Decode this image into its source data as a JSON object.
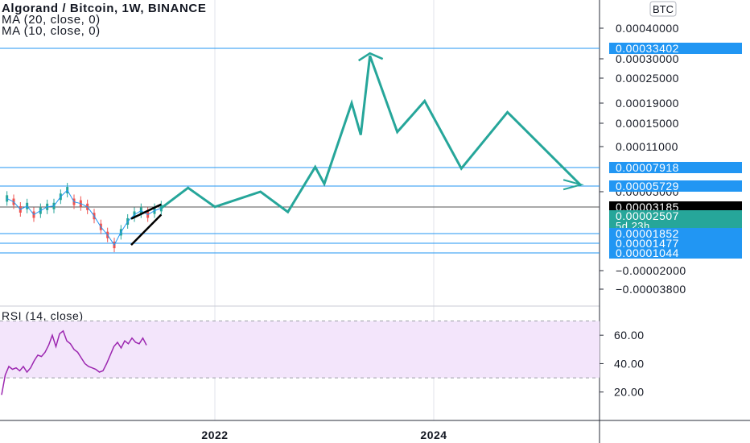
{
  "header": {
    "title": "Algorand / Bitcoin, 1W, BINANCE",
    "indicator_1": "MA (20, close, 0)",
    "indicator_2": "MA (10, close, 0)",
    "currency_badge": "BTC"
  },
  "rsi_panel": {
    "title": "RSI (14, close)",
    "upper_band": 70,
    "lower_band": 30,
    "band_fill": "#f3e5fb",
    "line_color": "#9c27b0"
  },
  "colors": {
    "projection": "#26a69a",
    "hline": "#2196f3",
    "price_tag_dark": "#000000",
    "price_tag_current": "#26a69a",
    "grid": "#e0e3eb"
  },
  "chart_data": [
    {
      "type": "line",
      "panel": "price",
      "title": "Algorand / Bitcoin, 1W, BINANCE",
      "x_ticks": [
        "2022",
        "2024"
      ],
      "y_ticks": [
        "0.00040000",
        "0.00030000",
        "0.00025000",
        "0.00019000",
        "0.00015000",
        "0.00011000",
        "0.00005000",
        "−0.00002000",
        "−0.00003800"
      ],
      "price_tags": [
        {
          "label": "0.00033402",
          "value": 0.00033402,
          "style": "blue"
        },
        {
          "label": "0.00007918",
          "value": 7.918e-05,
          "style": "blue"
        },
        {
          "label": "0.00005729",
          "value": 5.729e-05,
          "style": "blue"
        },
        {
          "label": "0.00003185",
          "value": 3.185e-05,
          "style": "dark"
        },
        {
          "label": "0.00002507",
          "value": 2.507e-05,
          "style": "current",
          "countdown": "5d 23h"
        },
        {
          "label": "0.00001852",
          "value": 1.852e-05,
          "style": "blue"
        },
        {
          "label": "0.00001477",
          "value": 1.477e-05,
          "style": "blue"
        },
        {
          "label": "0.00001044",
          "value": 1.044e-05,
          "style": "blue"
        }
      ],
      "horizontal_levels": [
        0.00033402,
        7.918e-05,
        5.729e-05,
        3.185e-05,
        1.852e-05,
        1.477e-05,
        1.044e-05
      ],
      "price_series": {
        "x": [
          "2019-06",
          "2019-07",
          "2019-08",
          "2019-09",
          "2019-10",
          "2019-11",
          "2019-12",
          "2020-01",
          "2020-02",
          "2020-03",
          "2020-04",
          "2020-05",
          "2020-06",
          "2020-07",
          "2020-08",
          "2020-09",
          "2020-10",
          "2020-11",
          "2020-12",
          "2021-01",
          "2021-02",
          "2021-03",
          "2021-04",
          "2021-05"
        ],
        "y": [
          4.2e-05,
          3.8e-05,
          3e-05,
          3.3e-05,
          2.6e-05,
          2.9e-05,
          3.2e-05,
          3.3e-05,
          4.4e-05,
          5.2e-05,
          3.8e-05,
          3.6e-05,
          3.2e-05,
          2.5e-05,
          2.1e-05,
          1.8e-05,
          1.4e-05,
          1.9e-05,
          2.3e-05,
          2.6e-05,
          2.9e-05,
          2.6e-05,
          2.9e-05,
          3.1e-05
        ]
      },
      "projection": {
        "name": "",
        "x": [
          "2021-05",
          "2021-09",
          "2022-01",
          "2022-06",
          "2022-09",
          "2022-12",
          "2023-01",
          "2023-04",
          "2023-05",
          "2023-06",
          "2023-09",
          "2023-12",
          "2024-04",
          "2024-09",
          "2025-05"
        ],
        "y": [
          3.1e-05,
          5.5e-05,
          3.2e-05,
          5e-05,
          2.8e-05,
          8e-05,
          6e-05,
          0.00019,
          0.00013,
          0.00031,
          0.000135,
          0.000195,
          7.8e-05,
          0.000172,
          5.8e-05
        ]
      }
    },
    {
      "type": "line",
      "panel": "indicator",
      "title": "RSI (14, close)",
      "y_ticks": [
        "60.00",
        "40.00",
        "20.00"
      ],
      "ylim": [
        0,
        80
      ],
      "series": [
        {
          "name": "",
          "x": [
            0,
            1,
            2,
            3,
            4,
            5,
            6,
            7,
            8,
            9,
            10,
            11,
            12,
            13,
            14,
            15,
            16,
            17,
            18,
            19,
            20,
            21,
            22,
            23,
            24,
            25,
            26,
            27,
            28,
            29,
            30,
            31,
            32,
            33,
            34,
            35,
            36,
            37,
            38,
            39,
            40
          ],
          "y": [
            18,
            32,
            38,
            36,
            37,
            35,
            38,
            34,
            37,
            42,
            46,
            45,
            48,
            53,
            60,
            52,
            61,
            63,
            56,
            54,
            50,
            48,
            44,
            40,
            38,
            37,
            36,
            34,
            35,
            40,
            46,
            52,
            55,
            51,
            56,
            54,
            58,
            55,
            54,
            58,
            53
          ]
        }
      ]
    }
  ]
}
